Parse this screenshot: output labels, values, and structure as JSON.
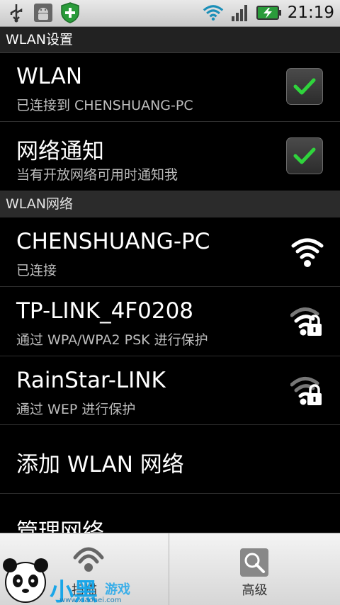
{
  "status_bar": {
    "time": "21:19",
    "icons_left": [
      "usb-icon",
      "android-debug-icon",
      "shield-plus-icon"
    ],
    "icons_right": [
      "wifi-signal-icon",
      "cell-signal-icon",
      "battery-charging-icon"
    ]
  },
  "title": "WLAN设置",
  "settings": [
    {
      "title": "WLAN",
      "summary": "已连接到 CHENSHUANG-PC",
      "checked": true
    },
    {
      "title": "网络通知",
      "summary": "当有开放网络可用时通知我",
      "checked": true
    }
  ],
  "networks_header": "WLAN网络",
  "networks": [
    {
      "ssid": "CHENSHUANG-PC",
      "status": "已连接",
      "secured": false
    },
    {
      "ssid": "TP-LINK_4F0208",
      "status": "通过 WPA/WPA2 PSK 进行保护",
      "secured": true
    },
    {
      "ssid": "RainStar-LINK",
      "status": "通过 WEP 进行保护",
      "secured": true
    }
  ],
  "add_network": "添加 WLAN 网络",
  "manage_networks": "管理网络",
  "bottom_bar": {
    "left_label": "扫描",
    "right_label": "高级",
    "left_icon": "scan-icon",
    "right_icon": "advanced-settings-icon"
  },
  "watermark": {
    "logo_main": "小黑",
    "logo_sub": "游戏",
    "url": "www.xiaohei.com"
  },
  "colors": {
    "check_green": "#2fd43c",
    "status_bar_bg": "#d8d8d8",
    "header_bg": "#2b2b2b"
  }
}
